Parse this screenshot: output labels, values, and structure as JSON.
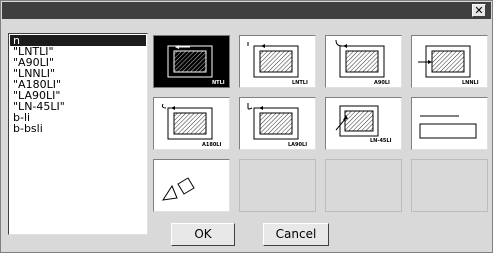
{
  "window": {
    "close_label": "✕"
  },
  "list": {
    "items": [
      "n",
      "\"LNTLI\"",
      "\"A90LI\"",
      "\"LNNLI\"",
      "\"A180LI\"",
      "\"LA90LI\"",
      "\"LN-45LI\"",
      "b-li",
      "b-bsli"
    ],
    "selected_index": 0
  },
  "thumbnails": {
    "captions": [
      "NTLI",
      "LNTLI",
      "A90LI",
      "LNNLI",
      "A180LI",
      "LA90LI",
      "LN-45LI"
    ]
  },
  "buttons": {
    "ok": "OK",
    "cancel": "Cancel"
  }
}
